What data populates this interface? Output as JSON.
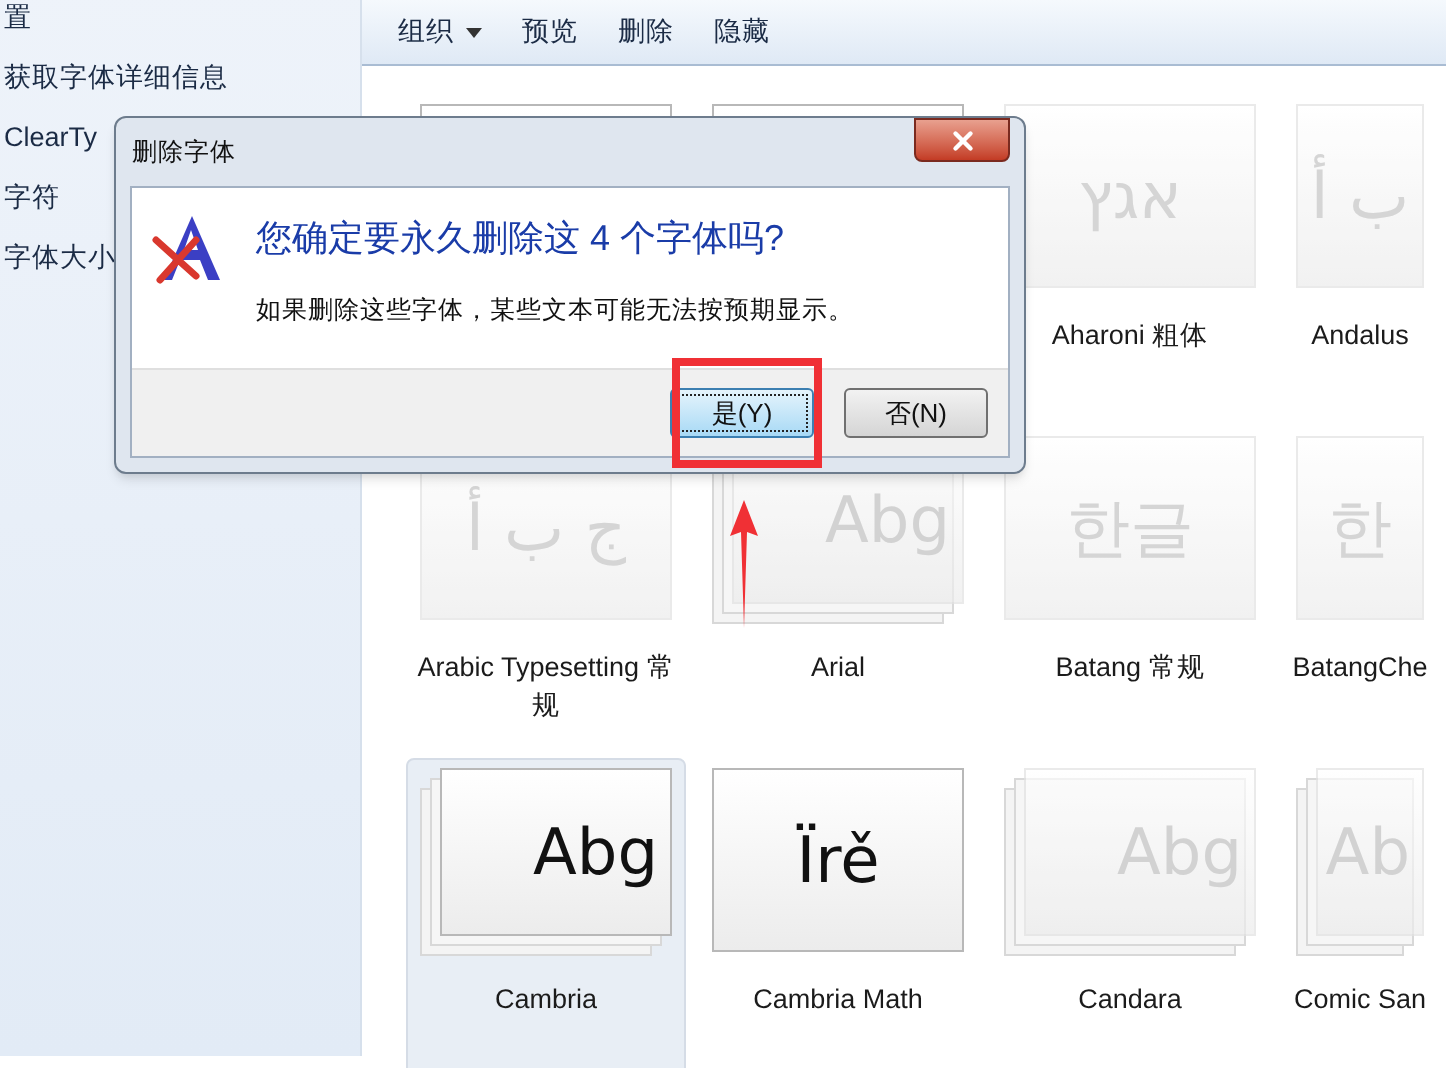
{
  "sidebar": {
    "items": [
      "置",
      "获取字体详细信息",
      "ClearTy",
      "字符",
      "字体大小"
    ]
  },
  "toolbar": {
    "items": [
      {
        "label": "组织",
        "dropdown": true
      },
      {
        "label": "预览",
        "dropdown": false
      },
      {
        "label": "删除",
        "dropdown": false
      },
      {
        "label": "隐藏",
        "dropdown": false
      }
    ]
  },
  "fonts": [
    {
      "selected": false
    },
    {
      "selected": false
    },
    {
      "preview": "אגץ",
      "label": "Aharoni 粗体",
      "hidden": true,
      "stacked": false,
      "selected": false
    },
    {
      "preview": "ب أ",
      "label": "Andalus",
      "hidden": true,
      "stacked": false,
      "selected": false
    },
    {
      "preview": "ج ب أ",
      "label": "Arabic Typesetting 常规",
      "hidden": true,
      "stacked": false,
      "selected": false
    },
    {
      "preview": "Abg",
      "label": "Arial",
      "hidden": true,
      "stacked": true,
      "selected": false
    },
    {
      "preview": "한글",
      "label": "Batang 常规",
      "hidden": true,
      "stacked": false,
      "selected": false
    },
    {
      "preview": "한",
      "label": "BatangChe",
      "hidden": true,
      "stacked": false,
      "selected": false
    },
    {
      "preview": "Abg",
      "label": "Cambria",
      "hidden": false,
      "stacked": true,
      "selected": true
    },
    {
      "preview": "Ïrě",
      "label": "Cambria Math",
      "hidden": false,
      "stacked": false,
      "selected": false
    },
    {
      "preview": "Abg",
      "label": "Candara",
      "hidden": true,
      "stacked": true,
      "selected": false
    },
    {
      "preview": "Ab",
      "label": "Comic San",
      "hidden": true,
      "stacked": true,
      "selected": false
    }
  ],
  "dialog": {
    "title": "删除字体",
    "heading": "您确定要永久删除这 4 个字体吗?",
    "message": "如果删除这些字体，某些文本可能无法按预期显示。",
    "buttons": [
      {
        "label": "是(Y)",
        "selected": true
      },
      {
        "label": "否(N)",
        "selected": false
      }
    ]
  }
}
